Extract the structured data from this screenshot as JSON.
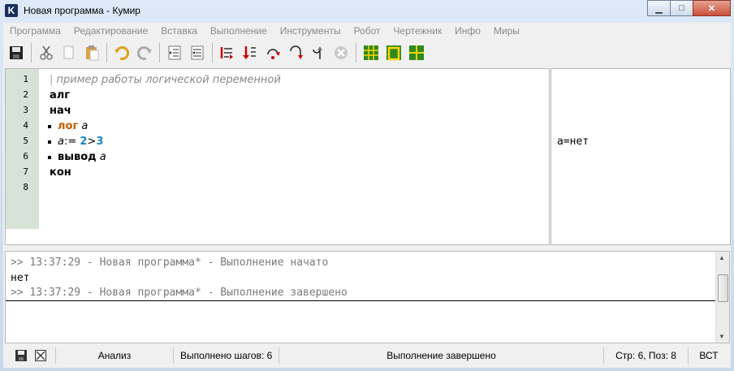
{
  "window": {
    "title": "Новая программа - Кумир",
    "app_icon_letter": "K",
    "controls": {
      "minimize": "▁",
      "maximize": "□",
      "close": "✕"
    }
  },
  "menu": [
    "Программа",
    "Редактирование",
    "Вставка",
    "Выполнение",
    "Инструменты",
    "Робот",
    "Чертежник",
    "Инфо",
    "Миры"
  ],
  "toolbar": [
    {
      "name": "save-icon"
    },
    {
      "name": "cut-icon"
    },
    {
      "name": "copy-icon"
    },
    {
      "name": "paste-icon"
    },
    {
      "name": "undo-icon"
    },
    {
      "name": "redo-icon"
    },
    {
      "name": "indent-icon"
    },
    {
      "name": "unindent-icon"
    },
    {
      "name": "run-regular-icon"
    },
    {
      "name": "run-blind-icon"
    },
    {
      "name": "step-over-icon"
    },
    {
      "name": "step-in-icon"
    },
    {
      "name": "step-out-icon"
    },
    {
      "name": "stop-icon"
    },
    {
      "name": "robot-world-icon"
    },
    {
      "name": "robot-window-icon"
    },
    {
      "name": "drawer-icon"
    }
  ],
  "colors": {
    "gutter": "#d6e3d6",
    "keyword_type": "#c05a00",
    "number": "#1a86c8",
    "comment": "#888888"
  },
  "editor": {
    "line_numbers": [
      "1",
      "2",
      "3",
      "4",
      "5",
      "6",
      "7",
      "8"
    ],
    "lines": {
      "l1_bar": "|",
      "l1_comment": " пример работы логической переменной",
      "l2": "алг",
      "l3": "нач",
      "l4_type": "лог",
      "l4_var": " а",
      "l5_var": "а",
      "l5_assign": ":= ",
      "l5_num1": "2",
      "l5_op": ">",
      "l5_num2": "3",
      "l6_kw": "вывод",
      "l6_var": " а",
      "l7": "кон"
    }
  },
  "side_output": {
    "value": "а=нет"
  },
  "console": {
    "line1": ">> 13:37:29 - Новая программа* - Выполнение начато",
    "line2": "нет",
    "line3": ">> 13:37:29 - Новая программа* - Выполнение завершено"
  },
  "statusbar": {
    "analysis": "Анализ",
    "steps": "Выполнено шагов: 6",
    "state": "Выполнение завершено",
    "position": "Стр: 6, Поз: 8",
    "mode": "ВСТ"
  }
}
